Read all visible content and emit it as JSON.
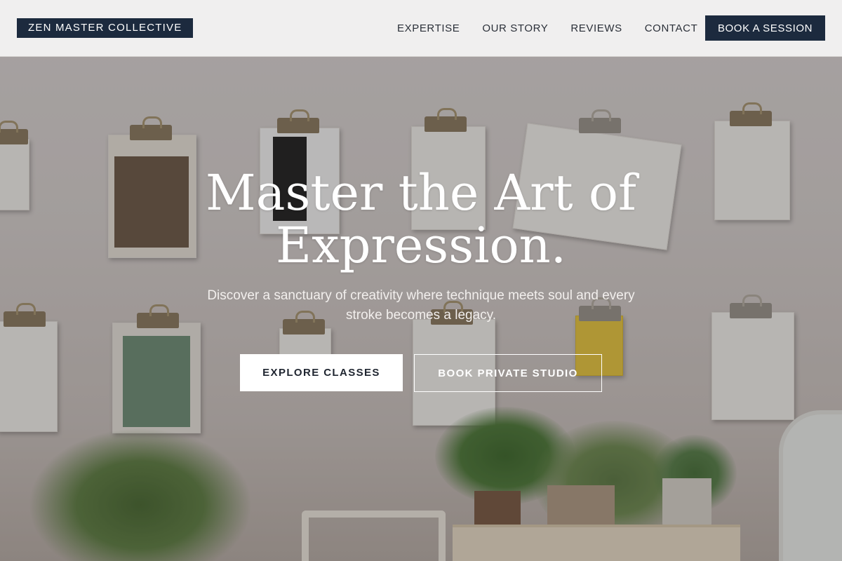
{
  "nav": {
    "logo": "ZEN MASTER COLLECTIVE",
    "links": [
      "EXPERTISE",
      "OUR STORY",
      "REVIEWS",
      "CONTACT"
    ],
    "cta": "BOOK A SESSION"
  },
  "hero": {
    "headline_line1": "Master the Art of",
    "headline_line2": "Expression.",
    "subheadline": "Discover a sanctuary of creativity where technique meets soul and every stroke becomes a legacy.",
    "primary_button": "EXPLORE CLASSES",
    "secondary_button": "BOOK PRIVATE STUDIO"
  },
  "colors": {
    "navy": "#1c2a3e",
    "nav_background": "#f3f3f2",
    "button_white": "#ffffff"
  }
}
